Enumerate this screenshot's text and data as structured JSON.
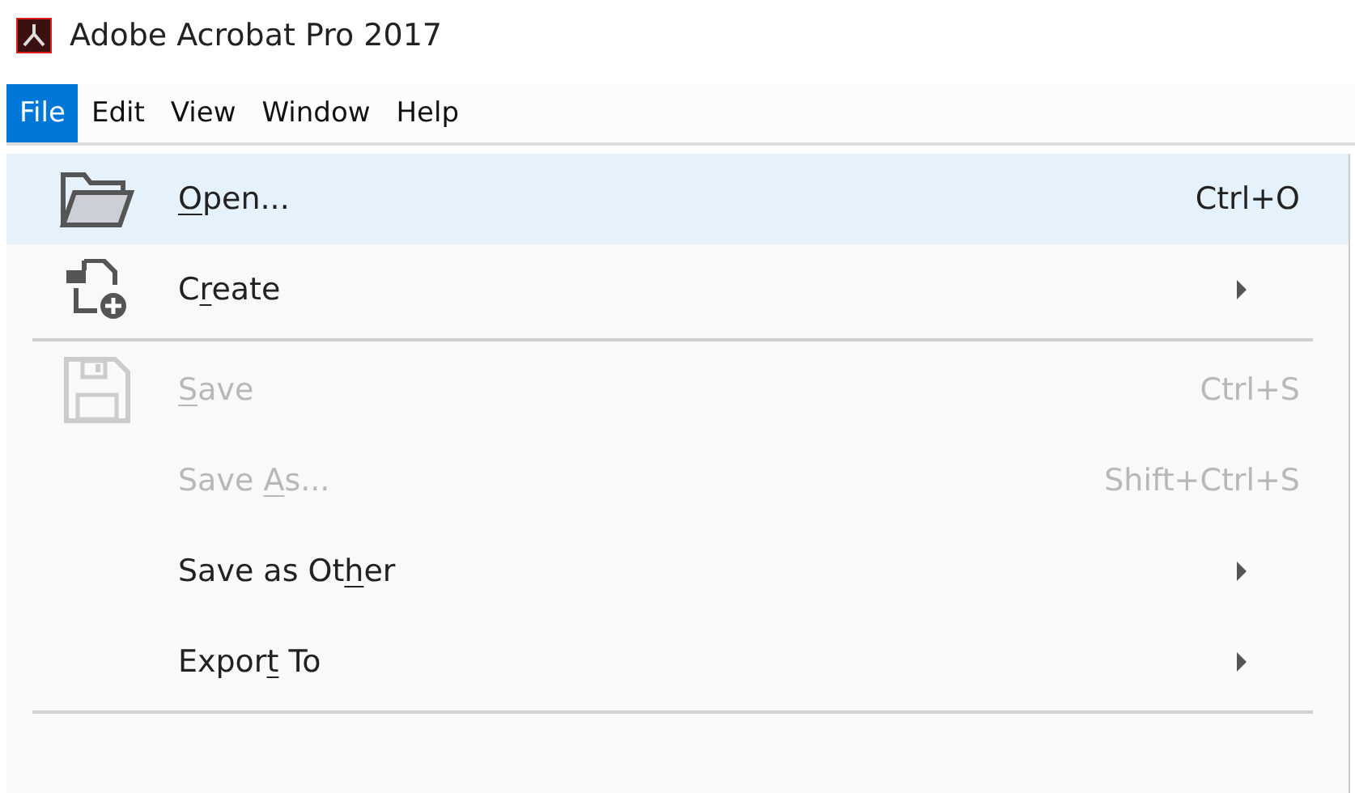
{
  "window": {
    "title": "Adobe Acrobat Pro 2017"
  },
  "menu_bar": [
    {
      "label": "File",
      "selected": true
    },
    {
      "label": "Edit",
      "selected": false
    },
    {
      "label": "View",
      "selected": false
    },
    {
      "label": "Window",
      "selected": false
    },
    {
      "label": "Help",
      "selected": false
    }
  ],
  "file_menu": [
    {
      "kind": "item",
      "label": [
        {
          "text": "O",
          "underlined": true
        },
        {
          "text": "pen...",
          "underlined": false
        }
      ],
      "shortcut": "Ctrl+O",
      "selected": true,
      "disabled": false,
      "submenu": false
    },
    {
      "kind": "item",
      "label": [
        {
          "text": "C",
          "underlined": false
        },
        {
          "text": "r",
          "underlined": true
        },
        {
          "text": "eate",
          "underlined": false
        }
      ],
      "selected": false,
      "disabled": false,
      "submenu": true
    },
    {
      "kind": "separator"
    },
    {
      "kind": "item",
      "label": [
        {
          "text": "S",
          "underlined": true
        },
        {
          "text": "ave",
          "underlined": false
        }
      ],
      "shortcut": "Ctrl+S",
      "selected": false,
      "disabled": true,
      "submenu": false
    },
    {
      "kind": "item",
      "label": [
        {
          "text": "Save ",
          "underlined": false
        },
        {
          "text": "A",
          "underlined": true
        },
        {
          "text": "s...",
          "underlined": false
        }
      ],
      "shortcut": "Shift+Ctrl+S",
      "selected": false,
      "disabled": true,
      "submenu": false
    },
    {
      "kind": "item",
      "label": [
        {
          "text": "Save as Ot",
          "underlined": false
        },
        {
          "text": "h",
          "underlined": true
        },
        {
          "text": "er",
          "underlined": false
        }
      ],
      "selected": false,
      "disabled": false,
      "submenu": true
    },
    {
      "kind": "item",
      "label": [
        {
          "text": "Expor",
          "underlined": false
        },
        {
          "text": "t",
          "underlined": true
        },
        {
          "text": " To",
          "underlined": false
        }
      ],
      "selected": false,
      "disabled": false,
      "submenu": true
    },
    {
      "kind": "separator"
    }
  ]
}
